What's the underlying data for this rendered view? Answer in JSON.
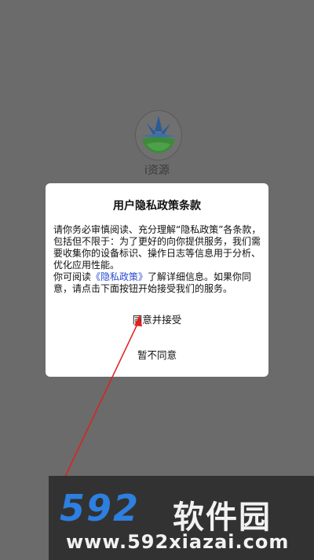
{
  "app": {
    "name": "i资源",
    "logo_icon": "mountain-sunrise-logo-icon"
  },
  "dialog": {
    "title": "用户隐私政策条款",
    "paragraph1": "请你务必审慎阅读、充分理解“隐私政策”各条款，包括但不限于：为了更好的向你提供服务，我们需要收集你的设备标识、操作日志等信息用于分析、优化应用性能。",
    "paragraph2_prefix": "你可阅读",
    "paragraph2_link": "《隐私政策》",
    "paragraph2_suffix": "了解详细信息。如果你同意，请点击下面按钮开始接受我们的服务。",
    "agree_label": "同意并接受",
    "disagree_label": "暂不同意"
  },
  "watermark": {
    "number": "592",
    "brand": "软件园",
    "url": "www.592xiazai.com"
  },
  "colors": {
    "overlay": "#6b6b6b",
    "link": "#2a4bd1",
    "arrow": "#e02020",
    "watermark_blue": "#2d7fe0"
  }
}
